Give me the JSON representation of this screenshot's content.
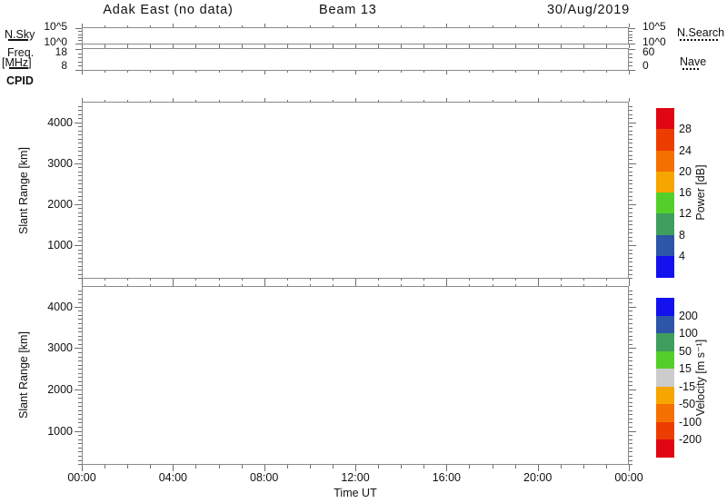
{
  "header": {
    "station_title": "Adak East (no data)",
    "beam_label": "Beam 13",
    "date": "30/Aug/2019"
  },
  "left_legend": {
    "nsky": "N.Sky",
    "freq_line1": "Freq.",
    "freq_line2": "[MHz]",
    "cpid": "CPID"
  },
  "right_legend": {
    "nsearch": "N.Search",
    "nave": "Nave"
  },
  "small_panels": {
    "nsky": {
      "left_top": "10^5",
      "left_bottom": "10^0",
      "right_top": "10^5",
      "right_bottom": "10^0"
    },
    "freq": {
      "left_top": "18",
      "left_bottom": "8",
      "right_top": "60",
      "right_bottom": "0"
    }
  },
  "xaxis": {
    "label": "Time UT",
    "tick_labels": [
      "00:00",
      "04:00",
      "08:00",
      "12:00",
      "16:00",
      "20:00",
      "00:00"
    ],
    "hour_range": [
      0,
      24
    ],
    "major_step_hours": 4,
    "minor_step_hours": 1
  },
  "yaxis": {
    "label": "Slant Range [km]",
    "tick_values": [
      1000,
      2000,
      3000,
      4000
    ],
    "range_km": [
      180,
      4500
    ],
    "minor_step_km": 100
  },
  "colorbars": {
    "power": {
      "label": "Power [dB]",
      "colors_top_to_bottom": [
        "#e00613",
        "#ed3c00",
        "#f57000",
        "#f7a500",
        "#54cf2a",
        "#3f9e5e",
        "#2d55a8",
        "#1411ef"
      ],
      "boundary_labels_top_to_bottom": [
        "28",
        "24",
        "20",
        "16",
        "12",
        "8",
        "4"
      ]
    },
    "velocity": {
      "label": "Velocity [m s⁻¹]",
      "colors_top_to_bottom": [
        "#1411ef",
        "#2d55a8",
        "#3f9e5e",
        "#54cf2a",
        "#cccccc",
        "#f7a500",
        "#f57000",
        "#ed3c00",
        "#e00613"
      ],
      "boundary_labels_top_to_bottom": [
        "200",
        "100",
        "50",
        "15",
        "-15",
        "-50",
        "-100",
        "-200"
      ]
    }
  },
  "chart_data": [
    {
      "id": "nsky",
      "type": "line",
      "ylabel": "N.Sky",
      "yscale": "log",
      "ytick_labels": [
        "10^0",
        "10^5"
      ],
      "x_hours": [
        0,
        24
      ],
      "series": [
        {
          "name": "N.Sky",
          "values": []
        },
        {
          "name": "N.Search",
          "values": []
        }
      ],
      "note": "no data plotted"
    },
    {
      "id": "freq",
      "type": "line",
      "ylabel": "Freq [MHz]",
      "left_axis_ticks": [
        8,
        18
      ],
      "right_axis_ticks": [
        0,
        60
      ],
      "x_hours": [
        0,
        24
      ],
      "series": [
        {
          "name": "Freq",
          "values": []
        },
        {
          "name": "Nave",
          "values": []
        }
      ],
      "note": "no data plotted"
    },
    {
      "id": "power",
      "type": "heatmap",
      "title": "Power panel",
      "xlabel": "Time UT",
      "ylabel": "Slant Range [km]",
      "x_ticks": [
        "00:00",
        "04:00",
        "08:00",
        "12:00",
        "16:00",
        "20:00",
        "00:00"
      ],
      "y_ticks": [
        1000,
        2000,
        3000,
        4000
      ],
      "y_range": [
        180,
        4500
      ],
      "color_scale_db": [
        4,
        8,
        12,
        16,
        20,
        24,
        28
      ],
      "values": [],
      "note": "no data plotted"
    },
    {
      "id": "velocity",
      "type": "heatmap",
      "title": "Velocity panel",
      "xlabel": "Time UT",
      "ylabel": "Slant Range [km]",
      "x_ticks": [
        "00:00",
        "04:00",
        "08:00",
        "12:00",
        "16:00",
        "20:00",
        "00:00"
      ],
      "y_ticks": [
        1000,
        2000,
        3000,
        4000
      ],
      "y_range": [
        180,
        4500
      ],
      "color_scale_ms": [
        -200,
        -100,
        -50,
        -15,
        15,
        50,
        100,
        200
      ],
      "values": [],
      "note": "no data plotted"
    }
  ]
}
